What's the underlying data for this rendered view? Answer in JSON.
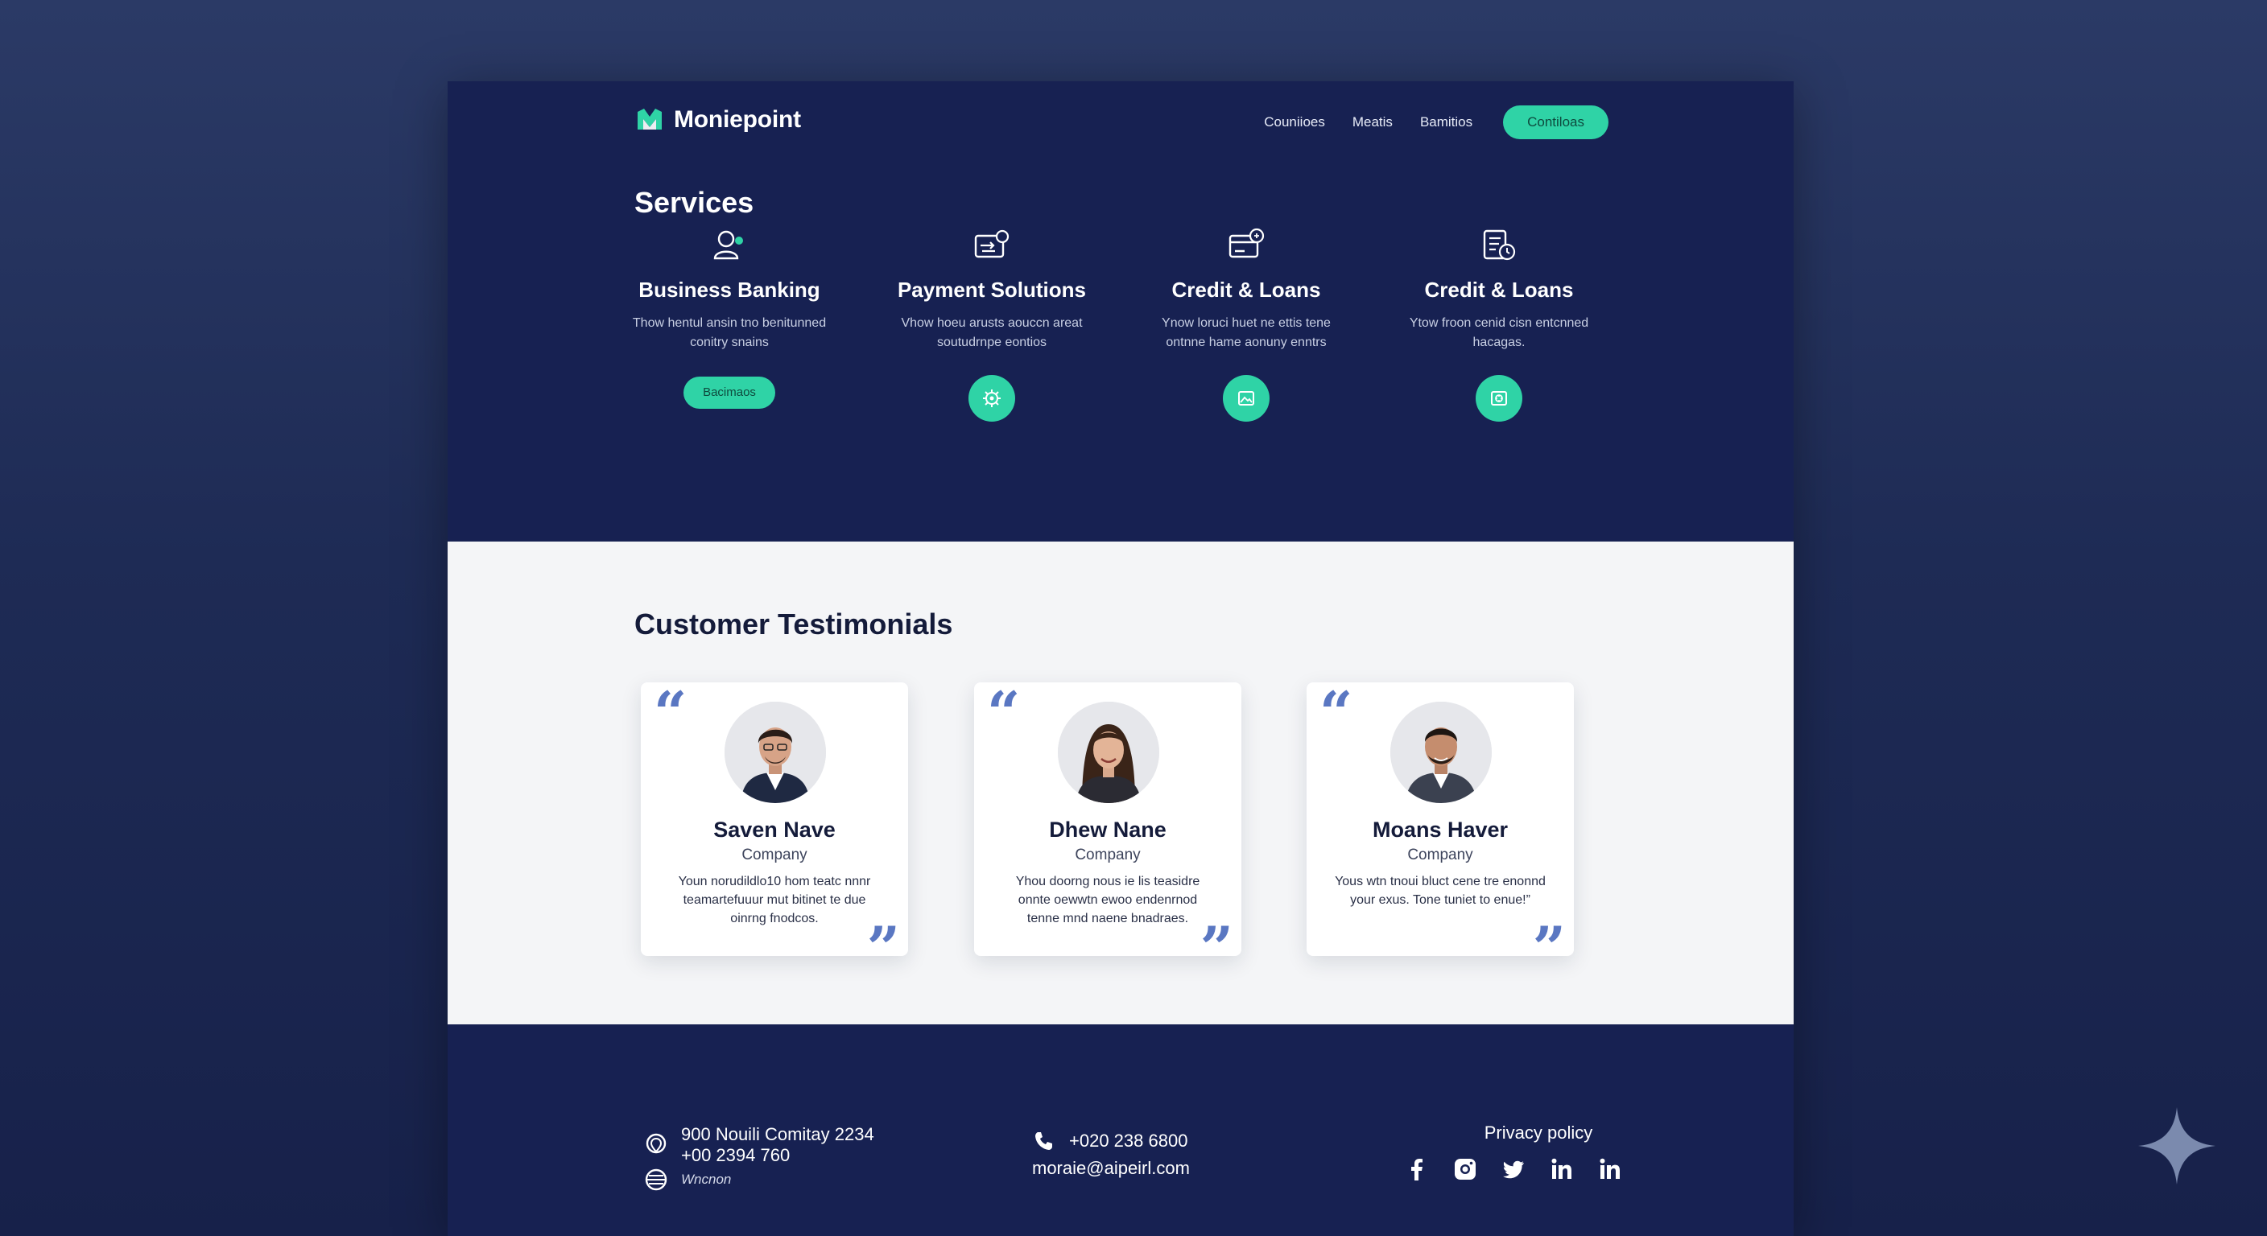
{
  "brand": {
    "name": "Moniepoint",
    "color": "#2fd3a6"
  },
  "nav": {
    "links": [
      "Couniioes",
      "Meatis",
      "Bamitios"
    ],
    "cta": "Contiloas"
  },
  "services": {
    "title": "Services",
    "items": [
      {
        "title": "Business Banking",
        "desc": "Thow hentul ansin tno benitunned conitry snains",
        "action": "button",
        "button_label": "Bacimaos",
        "icon": "user-coin-icon"
      },
      {
        "title": "Payment Solutions",
        "desc": "Vhow hoeu arusts aouccn areat soutudrnpe eontios",
        "action": "circle",
        "icon": "card-transfer-icon",
        "circle_icon": "gear-icon"
      },
      {
        "title": "Credit & Loans",
        "desc": "Ynow loruci huet ne ettis tene ontnne hame aonuny enntrs",
        "action": "circle",
        "icon": "card-coin-icon",
        "circle_icon": "image-card-icon"
      },
      {
        "title": "Credit & Loans",
        "desc": "Ytow froon cenid cisn entcnned hacagas.",
        "action": "circle",
        "icon": "document-clock-icon",
        "circle_icon": "safe-icon"
      }
    ]
  },
  "testimonials": {
    "title": "Customer Testimonials",
    "items": [
      {
        "name": "Saven Nave",
        "company": "Company",
        "text": "Youn norudildlo10 hom teatc nnnr teamartefuuur mut bitinet te due oinrng fnodcos."
      },
      {
        "name": "Dhew Nane",
        "company": "Company",
        "text": "Yhou doorng nous ie lis teasidre onnte oewwtn ewoo endenrnod tenne mnd naene bnadraes."
      },
      {
        "name": "Moans Haver",
        "company": "Company",
        "text": "Yous wtn tnoui bluct cene tre enonnd your exus. Tone tuniet to enue!”"
      }
    ]
  },
  "footer": {
    "address": "900 Nouili Comitay 2234",
    "phone_alt": "+00 2394 760",
    "website": "Wncnon",
    "phone": "+020 238 6800",
    "email": "moraie@aipeirl.com",
    "privacy": "Privacy policy",
    "socials": [
      "facebook-icon",
      "instagram-icon",
      "twitter-icon",
      "linkedin-icon",
      "linkedin-icon"
    ]
  },
  "colors": {
    "navy": "#172152",
    "accent": "#2fd3a6",
    "quote": "#5a77c2",
    "light_bg": "#f4f5f7"
  }
}
